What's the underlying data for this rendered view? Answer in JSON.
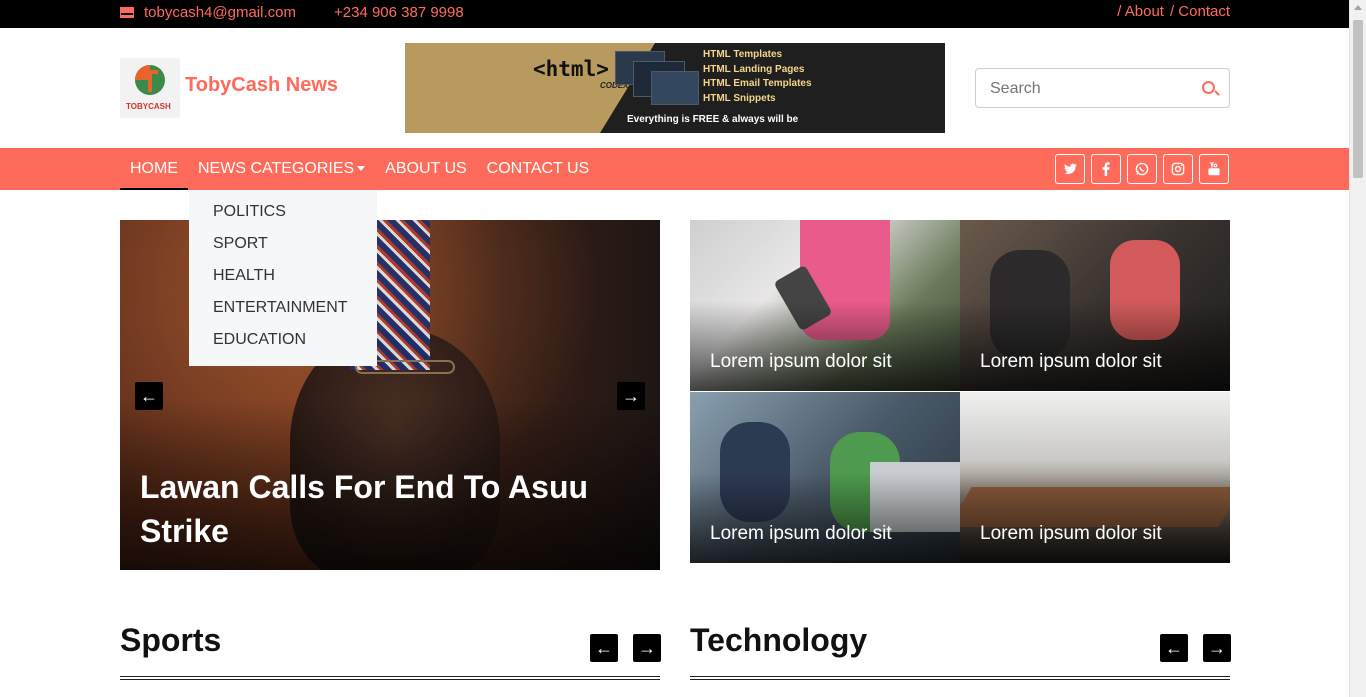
{
  "topbar": {
    "email": "tobycash4@gmail.com",
    "phone": "+234 906 387 9998",
    "about_link": "/ About",
    "contact_link": "/ Contact"
  },
  "header": {
    "brand": "TobyCash News",
    "logo_text": "TOBYCASH",
    "banner": {
      "html_tag": "<html>",
      "codex": "CODEX",
      "items": [
        "HTML Templates",
        "HTML Landing Pages",
        "HTML Email Templates",
        "HTML Snippets"
      ],
      "tagline": "Everything is FREE & always will be"
    },
    "search_placeholder": "Search"
  },
  "nav": {
    "items": [
      "HOME",
      "NEWS CATEGORIES",
      "ABOUT US",
      "CONTACT US"
    ],
    "active": "HOME",
    "social_icons": [
      "twitter-icon",
      "facebook-icon",
      "whatsapp-icon",
      "instagram-icon",
      "youtube-icon"
    ]
  },
  "dropdown": {
    "items": [
      "POLITICS",
      "SPORT",
      "HEALTH",
      "ENTERTAINMENT",
      "EDUCATION"
    ]
  },
  "hero": {
    "title": "Lawan Calls For End To Asuu Strike",
    "prev": "←",
    "next": "→"
  },
  "grid": {
    "tiles": [
      "Lorem ipsum dolor sit",
      "Lorem ipsum dolor sit",
      "Lorem ipsum dolor sit",
      "Lorem ipsum dolor sit"
    ]
  },
  "sections": {
    "left": "Sports",
    "right": "Technology",
    "prev": "←",
    "next": "→"
  },
  "colors": {
    "accent": "#ff6b5b",
    "topbar": "#000000",
    "dropdown_bg": "#f6f7f9"
  }
}
